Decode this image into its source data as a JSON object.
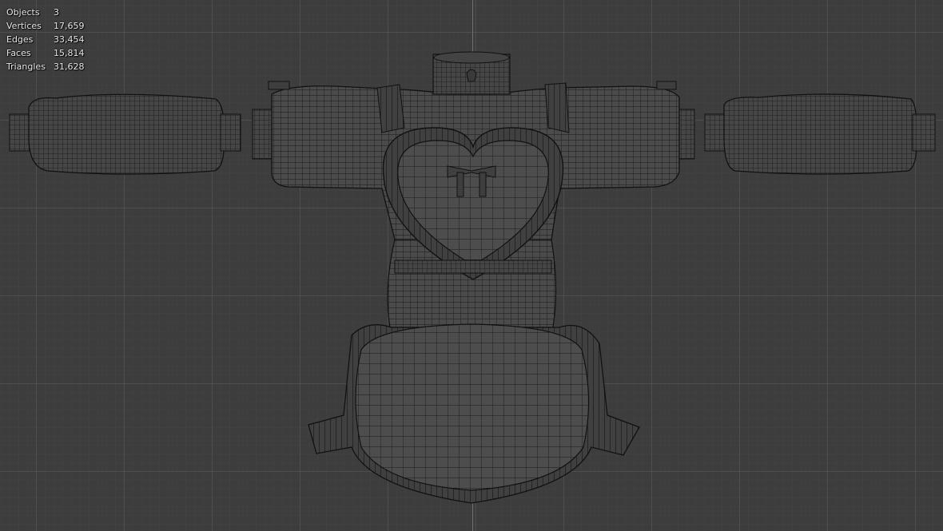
{
  "stats": [
    {
      "label": "Objects",
      "value": "3"
    },
    {
      "label": "Vertices",
      "value": "17,659"
    },
    {
      "label": "Edges",
      "value": "33,454"
    },
    {
      "label": "Faces",
      "value": "15,814"
    },
    {
      "label": "Triangles",
      "value": "31,628"
    }
  ],
  "colors": {
    "background": "#3d3d3d",
    "grid": "#5a5a5a",
    "mesh_fill": "#4a4a4a",
    "wire": "#111111",
    "z_axis": "#4a78b4",
    "text": "#e8e8e8"
  },
  "viewport": {
    "view": "front-orthographic",
    "shading": "wireframe",
    "model": "maid-outfit-mesh"
  }
}
